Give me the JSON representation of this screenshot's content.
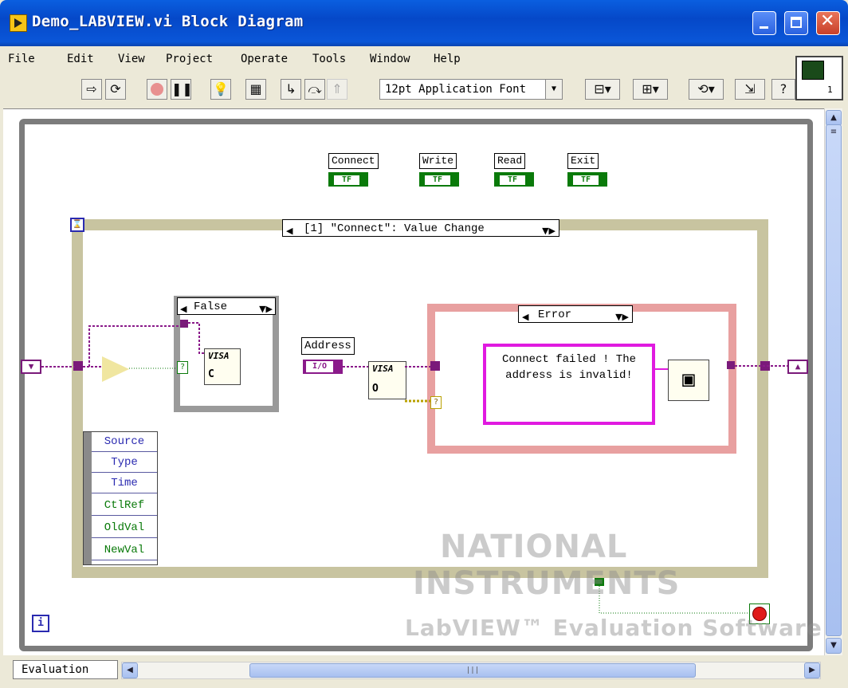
{
  "window": {
    "title": "Demo_LABVIEW.vi Block Diagram"
  },
  "menu": {
    "items": [
      {
        "label": "File"
      },
      {
        "label": "Edit"
      },
      {
        "label": "View"
      },
      {
        "label": "Project"
      },
      {
        "label": "Operate"
      },
      {
        "label": "Tools"
      },
      {
        "label": "Window"
      },
      {
        "label": "Help"
      }
    ]
  },
  "toolbar": {
    "font": "12pt Application Font"
  },
  "connector_pane": {
    "number": "1"
  },
  "diagram": {
    "controls": [
      {
        "label": "Connect",
        "type": "TF"
      },
      {
        "label": "Write",
        "type": "TF"
      },
      {
        "label": "Read",
        "type": "TF"
      },
      {
        "label": "Exit",
        "type": "TF"
      }
    ],
    "event_selector": "[1] \"Connect\": Value Change",
    "case_false": "False",
    "case_error": "Error",
    "address_label": "Address",
    "address_term": "I/O",
    "visa_label": "VISA",
    "visa_c": "C",
    "visa_o": "O",
    "question_mark": "?",
    "message_text": "Connect failed ! The address is invalid!",
    "event_data": [
      "Source",
      "Type",
      "Time",
      "CtlRef",
      "OldVal",
      "NewVal"
    ],
    "loop_iteration": "i",
    "event_timeout_icon": "hourglass-icon"
  },
  "watermark": {
    "line1": "NATIONAL",
    "line2": "INSTRUMENTS",
    "line3": "LabVIEW™ Evaluation Software"
  },
  "statusbar": {
    "tab": "Evaluation"
  },
  "colors": {
    "titlebar": "#0a56d8",
    "bool_wire": "#0a7a0a",
    "visa_wire": "#8a1a8a",
    "string_wire": "#e01ae0",
    "error_case": "#d05050"
  }
}
